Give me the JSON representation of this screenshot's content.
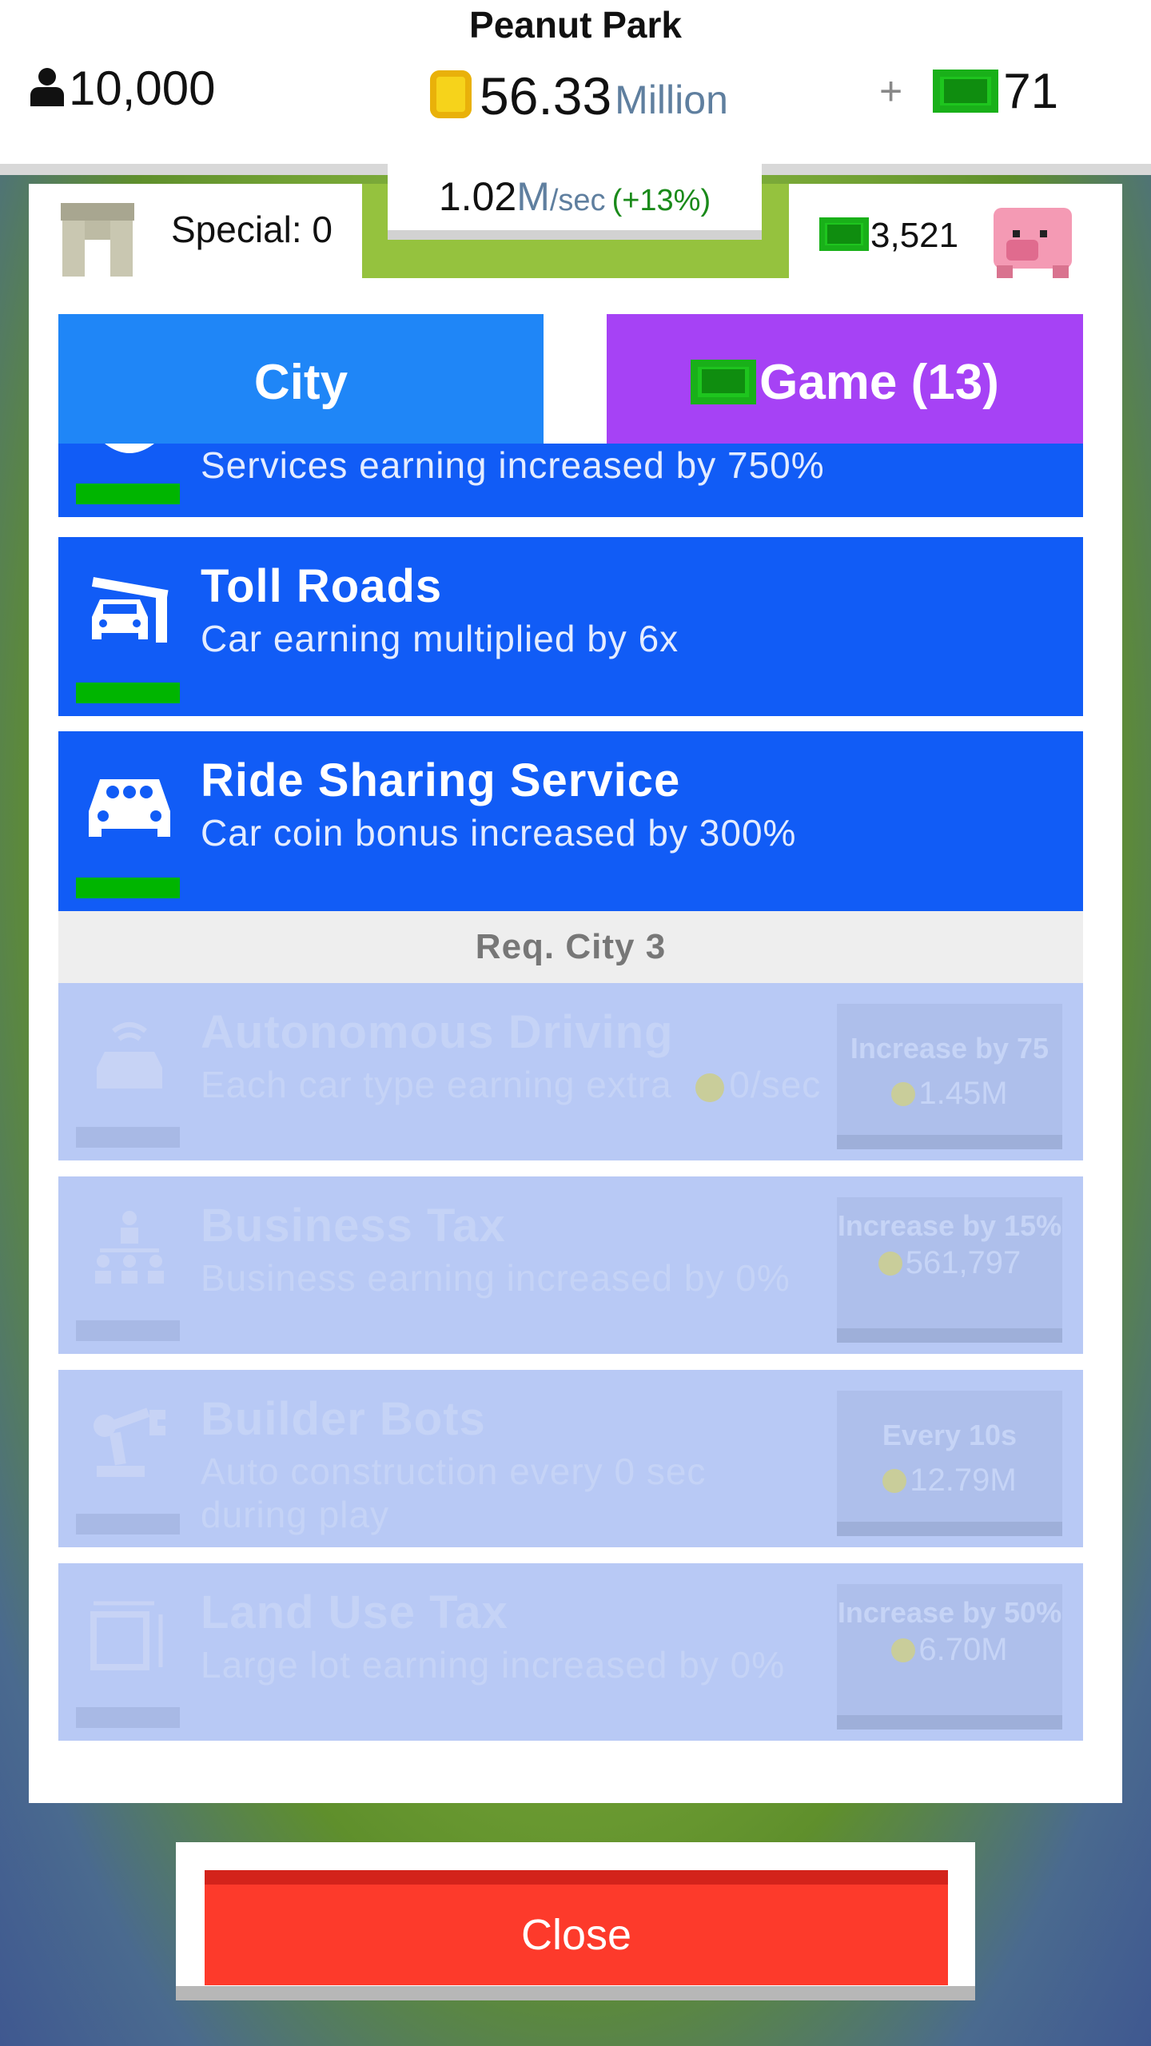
{
  "header": {
    "park_name": "Peanut Park",
    "population": "10,000",
    "money_amount": "56.33",
    "money_unit": "Million",
    "plus": "+",
    "gem_count": "71"
  },
  "rate": {
    "value": "1.02",
    "unit_m": "M",
    "per": "/sec",
    "bonus": "(+13%)"
  },
  "special": {
    "label": "Special: 0"
  },
  "cash": {
    "value": "3,521"
  },
  "tabs": {
    "city": "City",
    "game": "Game (13)"
  },
  "items": [
    {
      "title": "",
      "desc": "Services earning increased by 750%"
    },
    {
      "title": "Toll Roads",
      "desc": "Car earning multiplied by 6x"
    },
    {
      "title": "Ride Sharing Service",
      "desc": "Car coin bonus increased by 300%"
    }
  ],
  "requirement": "Req. City 3",
  "locked_items": [
    {
      "title": "Autonomous Driving",
      "desc": "Each car type earning extra",
      "desc_extra": "0/sec",
      "btn_label": "Increase by 75",
      "btn_cost": "1.45M"
    },
    {
      "title": "Business Tax",
      "desc": "Business earning increased by 0%",
      "btn_label": "Increase by 15%",
      "btn_cost": "561,797"
    },
    {
      "title": "Builder Bots",
      "desc": "Auto construction every 0 sec during play",
      "btn_label": "Every 10s",
      "btn_cost": "12.79M"
    },
    {
      "title": "Land Use Tax",
      "desc": "Large lot earning increased by 0%",
      "btn_label": "Increase by 50%",
      "btn_cost": "6.70M"
    }
  ],
  "close_label": "Close",
  "colors": {
    "city_tab": "#1f86f7",
    "game_tab": "#a642f5",
    "item_bg": "#115cf6",
    "locked_bg": "#b8c9f5",
    "progress": "#00b500",
    "close": "#fd3a2b"
  }
}
